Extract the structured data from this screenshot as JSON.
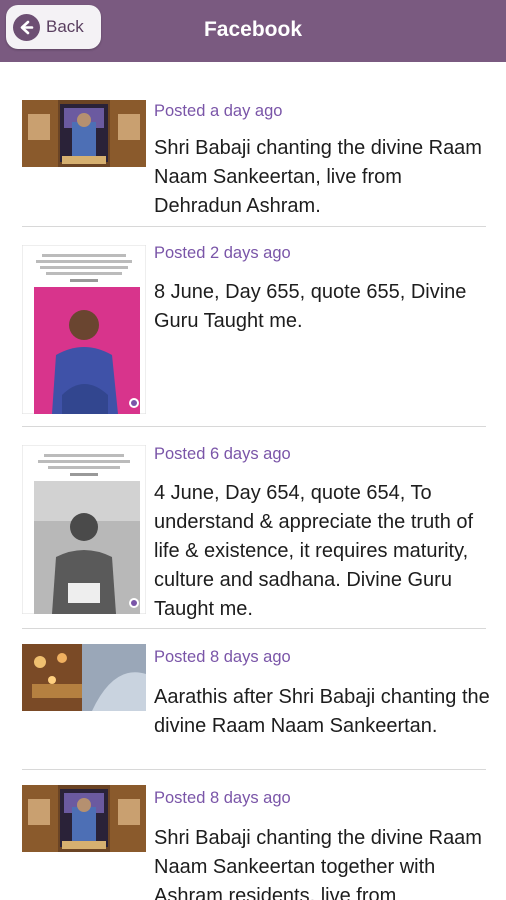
{
  "header": {
    "back_label": "Back",
    "title": "Facebook"
  },
  "posts": [
    {
      "posted": "Posted a day ago",
      "text": "Shri Babaji chanting the divine Raam Naam Sankeertan, live from Dehradun Ashram.",
      "thumb": "temple-altar-photo"
    },
    {
      "posted": "Posted 2 days ago",
      "text": "8 June, Day 655, quote 655, Divine Guru Taught me.",
      "thumb": "guru-quote-card-pink"
    },
    {
      "posted": "Posted 6 days ago",
      "text": "4 June, Day 654, quote 654, To understand & appreciate the truth of life & existence, it requires maturity, culture and sadhana. Divine Guru Taught me.",
      "thumb": "guru-quote-card-bw"
    },
    {
      "posted": "Posted 8 days ago",
      "text": "Aarathis after Shri Babaji chanting the divine Raam Naam Sankeertan.",
      "thumb": "aarathi-hall-photo"
    },
    {
      "posted": "Posted 8 days ago",
      "text": "Shri Babaji chanting the divine Raam Naam Sankeertan together with Ashram residents, live from",
      "thumb": "temple-altar-photo"
    }
  ]
}
